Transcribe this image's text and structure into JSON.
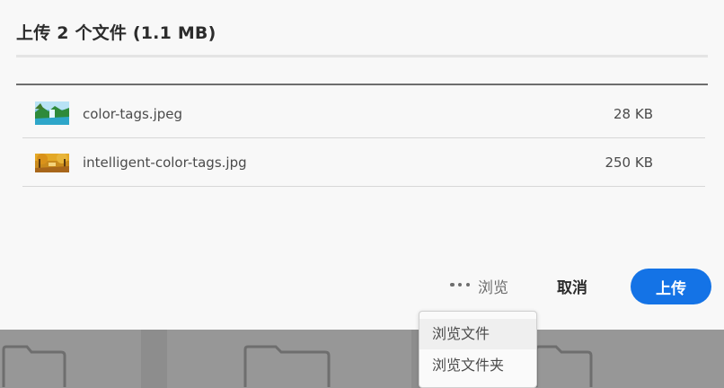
{
  "dialog": {
    "title": "上传 2 个文件 (1.1 MB)"
  },
  "files": [
    {
      "name": "color-tags.jpeg",
      "size": "28 KB",
      "thumbnail_icon": "landscape-thumbnail"
    },
    {
      "name": "intelligent-color-tags.jpg",
      "size": "250 KB",
      "thumbnail_icon": "autumn-thumbnail"
    }
  ],
  "actions": {
    "more_icon": "more-dots-icon",
    "browse_label": "浏览",
    "cancel_label": "取消",
    "upload_label": "上传"
  },
  "browse_menu": {
    "items": [
      "浏览文件",
      "浏览文件夹"
    ]
  },
  "colors": {
    "primary": "#1473e6",
    "text": "#2c2c2c",
    "muted": "#6e6e6e"
  }
}
